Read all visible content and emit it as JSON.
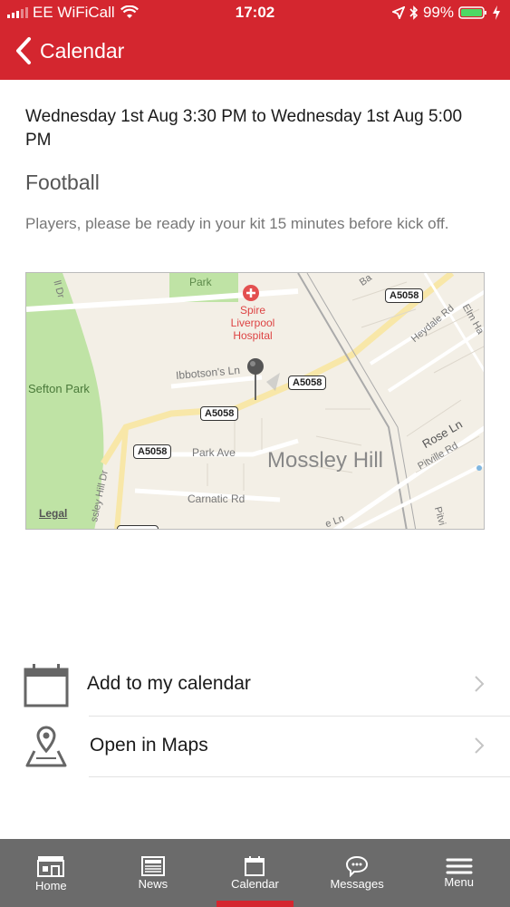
{
  "status_bar": {
    "carrier": "EE WiFiCall",
    "time": "17:02",
    "battery_percent": "99%"
  },
  "nav": {
    "back_label": "Calendar"
  },
  "event": {
    "datetime": "Wednesday 1st Aug 3:30 PM to Wednesday 1st Aug 5:00 PM",
    "title": "Football",
    "description": "Players, please be ready in your kit 15 minutes before kick off."
  },
  "map": {
    "labels": {
      "park": "Park",
      "hospital": "Spire Liverpool Hospital",
      "sefton_park": "Sefton Park",
      "ibbotsons_ln": "Ibbotson's Ln",
      "park_ave": "Park Ave",
      "carnatic_rd": "Carnatic Rd",
      "mossley_hill": "Mossley Hill",
      "heydale_rd": "Heydale Rd",
      "elm_hall": "Elm Ha",
      "rose_ln": "Rose Ln",
      "pitville_rd": "Pitville Rd",
      "mossley_hill_dr": "ssley Hill Dr",
      "ln": "e Ln",
      "ll_dr": "ll Dr",
      "pitvi": "Pitvi",
      "ba": "Ba"
    },
    "shields": [
      "A5058",
      "A5058",
      "A5058",
      "A5058"
    ],
    "legal": "Legal"
  },
  "actions": {
    "add_calendar": "Add to my calendar",
    "open_maps": "Open in Maps"
  },
  "tabs": [
    {
      "label": "Home"
    },
    {
      "label": "News"
    },
    {
      "label": "Calendar"
    },
    {
      "label": "Messages"
    },
    {
      "label": "Menu"
    }
  ],
  "colors": {
    "brand": "#d4262f",
    "tab_bar": "#6b6b6b"
  }
}
